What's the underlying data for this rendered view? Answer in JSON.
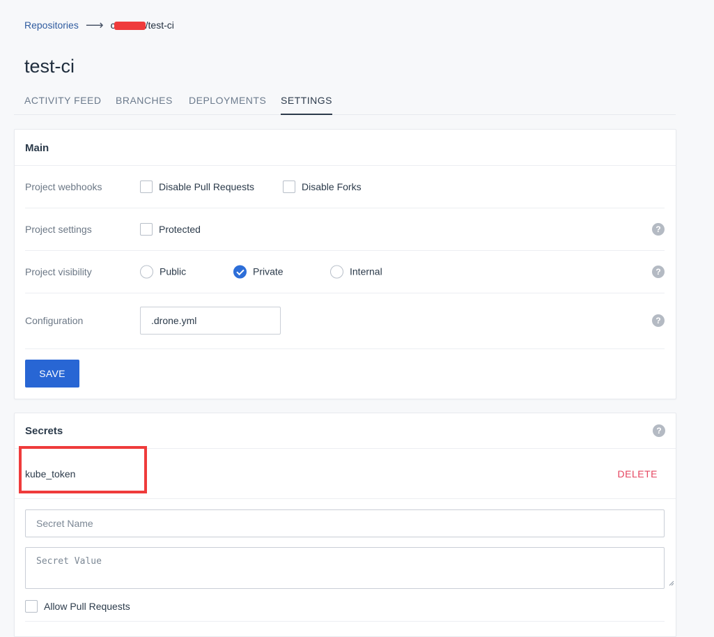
{
  "breadcrumb": {
    "repositories": "Repositories",
    "separator": "⟶",
    "owner_visible": "c",
    "repo": "/test-ci"
  },
  "title": "test-ci",
  "tabs": [
    {
      "label": "ACTIVITY FEED",
      "active": false
    },
    {
      "label": "BRANCHES",
      "active": false
    },
    {
      "label": "DEPLOYMENTS",
      "active": false
    },
    {
      "label": "SETTINGS",
      "active": true
    }
  ],
  "main": {
    "header": "Main",
    "webhooks": {
      "label": "Project webhooks",
      "disable_pull_requests": "Disable Pull Requests",
      "disable_forks": "Disable Forks"
    },
    "settings": {
      "label": "Project settings",
      "protected": "Protected"
    },
    "visibility": {
      "label": "Project visibility",
      "options": [
        "Public",
        "Private",
        "Internal"
      ],
      "selected": "Private"
    },
    "configuration": {
      "label": "Configuration",
      "value": ".drone.yml"
    },
    "save_label": "SAVE",
    "help_glyph": "?"
  },
  "secrets": {
    "header": "Secrets",
    "items": [
      {
        "name": "kube_token",
        "delete_label": "DELETE"
      }
    ],
    "name_placeholder": "Secret Name",
    "value_placeholder": "Secret Value",
    "allow_pull_requests": "Allow Pull Requests"
  },
  "colors": {
    "accent": "#2866d4",
    "delete": "#e5445f",
    "highlight": "#ef3b3b"
  }
}
